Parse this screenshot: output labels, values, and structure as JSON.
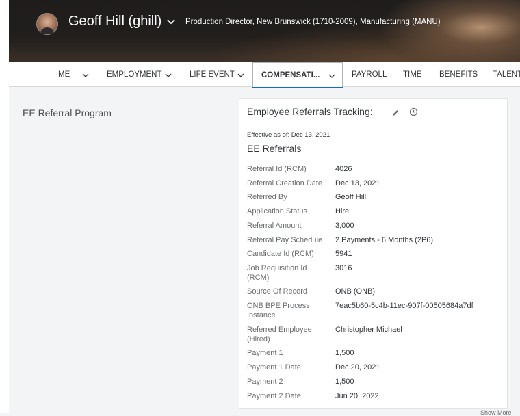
{
  "header": {
    "user_name": "Geoff Hill (ghill)",
    "user_title": "Production Director, New Brunswick (1710-2009), Manufacturing (MANU)"
  },
  "tabs": [
    {
      "label": "ME",
      "has_dropdown": true,
      "selected": false
    },
    {
      "label": "EMPLOYMENT",
      "has_dropdown": true,
      "selected": false
    },
    {
      "label": "LIFE EVENT",
      "has_dropdown": true,
      "selected": false
    },
    {
      "label": "COMPENSATI...",
      "has_dropdown": true,
      "selected": true
    },
    {
      "label": "PAYROLL",
      "has_dropdown": false,
      "selected": false
    },
    {
      "label": "TIME",
      "has_dropdown": false,
      "selected": false
    },
    {
      "label": "BENEFITS",
      "has_dropdown": false,
      "selected": false
    },
    {
      "label": "TALENT",
      "has_dropdown": false,
      "selected": false
    }
  ],
  "section_title": "EE Referral Program",
  "card": {
    "title": "Employee Referrals Tracking:",
    "effective": "Effective as of: Dec 13, 2021",
    "subtitle": "EE Referrals",
    "fields": [
      {
        "label": "Referral Id (RCM)",
        "value": "4026"
      },
      {
        "label": "Referral Creation Date",
        "value": "Dec 13, 2021"
      },
      {
        "label": "Referred By",
        "value": "Geoff Hill"
      },
      {
        "label": "Application Status",
        "value": "Hire"
      },
      {
        "label": "Referral Amount",
        "value": "3,000"
      },
      {
        "label": "Referral Pay Schedule",
        "value": "2 Payments - 6 Months (2P6)"
      },
      {
        "label": "Candidate Id (RCM)",
        "value": "5941"
      },
      {
        "label": "Job Requisition Id (RCM)",
        "value": "3016"
      },
      {
        "label": "Source Of Record",
        "value": "ONB (ONB)"
      },
      {
        "label": "ONB BPE Process Instance",
        "value": "7eac5b60-5c4b-11ec-907f-00505684a7df"
      },
      {
        "label": "Referred Employee (Hired)",
        "value": "Christopher Michael"
      },
      {
        "label": "Payment 1",
        "value": "1,500"
      },
      {
        "label": "Payment 1 Date",
        "value": "Dec 20, 2021"
      },
      {
        "label": "Payment 2",
        "value": "1,500"
      },
      {
        "label": "Payment 2 Date",
        "value": "Jun 20, 2022"
      }
    ]
  },
  "footer_text": "Show More",
  "colors": {
    "accent": "#0a6ed1",
    "header_bg": "#1f1d1c",
    "page_bg": "#f3f4f5"
  },
  "icons": [
    "user-avatar",
    "chevron-down-icon",
    "pencil-icon",
    "history-icon"
  ]
}
